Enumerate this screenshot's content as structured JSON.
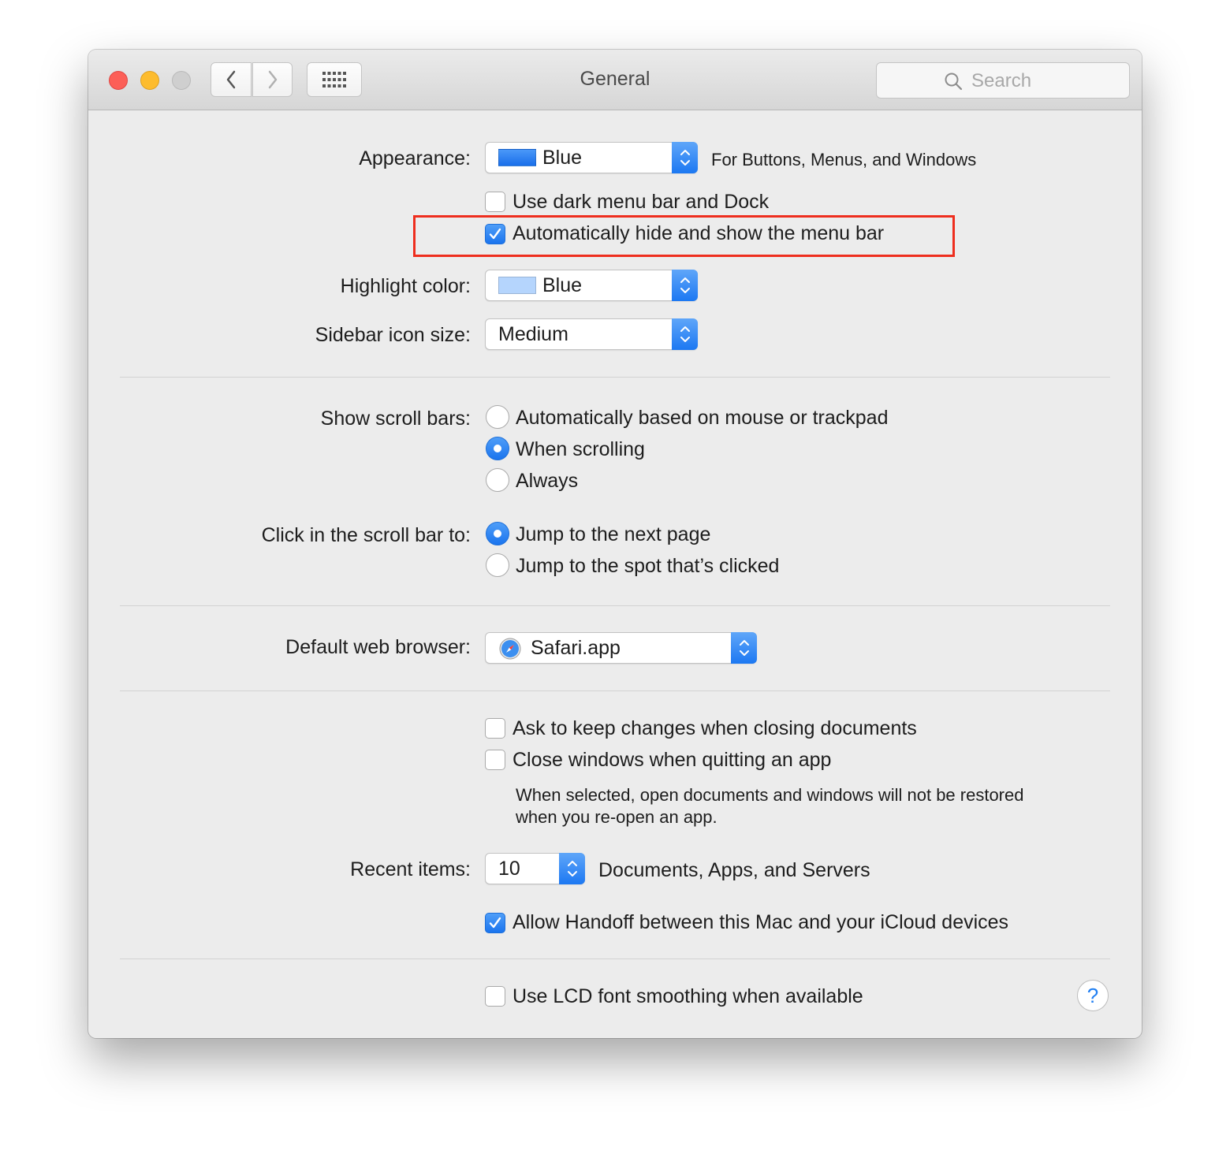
{
  "window": {
    "title": "General"
  },
  "toolbar": {
    "search_placeholder": "Search"
  },
  "appearance": {
    "label": "Appearance:",
    "value": "Blue",
    "swatch_color": "#1f7cf2",
    "note": "For Buttons, Menus, and Windows",
    "dark_menu_bar": {
      "label": "Use dark menu bar and Dock",
      "checked": false
    },
    "auto_hide_menu_bar": {
      "label": "Automatically hide and show the menu bar",
      "checked": true
    }
  },
  "highlight": {
    "label": "Highlight color:",
    "value": "Blue",
    "swatch_color": "#b5d5fd"
  },
  "sidebar_icon": {
    "label": "Sidebar icon size:",
    "value": "Medium"
  },
  "scroll_bars": {
    "label": "Show scroll bars:",
    "options": [
      "Automatically based on mouse or trackpad",
      "When scrolling",
      "Always"
    ],
    "selected": "When scrolling"
  },
  "click_scroll": {
    "label": "Click in the scroll bar to:",
    "options": [
      "Jump to the next page",
      "Jump to the spot that’s clicked"
    ],
    "selected": "Jump to the next page"
  },
  "browser": {
    "label": "Default web browser:",
    "value": "Safari.app"
  },
  "documents": {
    "ask_keep_changes": {
      "label": "Ask to keep changes when closing documents",
      "checked": false
    },
    "close_windows": {
      "label": "Close windows when quitting an app",
      "checked": false
    },
    "note_line1": "When selected, open documents and windows will not be restored",
    "note_line2": "when you re-open an app."
  },
  "recent_items": {
    "label": "Recent items:",
    "value": "10",
    "note": "Documents, Apps, and Servers"
  },
  "handoff": {
    "label": "Allow Handoff between this Mac and your iCloud devices",
    "checked": true
  },
  "lcd_smoothing": {
    "label": "Use LCD font smoothing when available",
    "checked": false
  },
  "help": {
    "glyph": "?"
  },
  "colors": {
    "accent": "#1f7ef2",
    "annotation": "#ee2e1e"
  }
}
